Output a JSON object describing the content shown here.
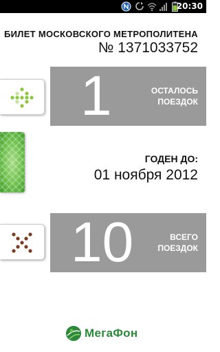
{
  "status_bar": {
    "time": "20:30",
    "icons": [
      "nfc-icon",
      "sync-icon",
      "wifi-icon",
      "signal-icon",
      "battery-icon"
    ],
    "background": "#000000"
  },
  "ticket": {
    "title": "БИЛЕТ МОСКОВСКОГО МЕТРОПОЛИТЕНА",
    "number": "№ 1371033752"
  },
  "remaining": {
    "count": "1",
    "label": "ОСТАЛОСЬ\nПОЕЗДОК",
    "icon": "green-dots-arrow-icon"
  },
  "validity": {
    "label": "ГОДЕН ДО:",
    "date": "01 ноября 2012"
  },
  "total": {
    "count": "10",
    "label": "ВСЕГО\nПОЕЗДОК",
    "icon": "brown-dots-cross-icon"
  },
  "brand": {
    "name": "МегаФон",
    "color": "#2a8a3a",
    "accent": "#6cbf4a"
  },
  "colors": {
    "panel": "#9a9a9a",
    "panel_text": "#ffffff",
    "card_green": "#6cbf4a",
    "dots_green": "#8dc63f",
    "dots_brown": "#7a3b1e"
  }
}
